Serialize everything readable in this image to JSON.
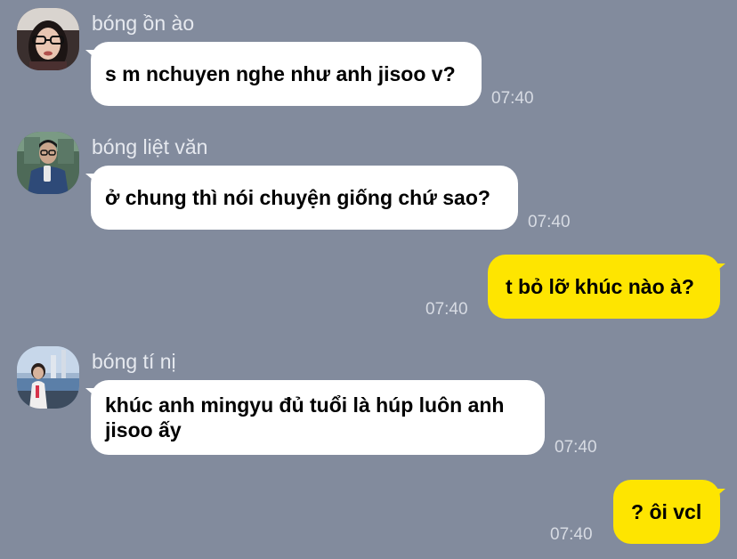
{
  "colors": {
    "background": "#828b9d",
    "incoming_bubble": "#ffffff",
    "outgoing_bubble": "#fee500",
    "name_text": "#e6e9ef",
    "time_text": "#d7dbe3"
  },
  "messages": [
    {
      "sender": "bóng ồn ào",
      "avatar": "avatar-photo-glasses",
      "text": "s m nchuyen nghe như anh jisoo v?",
      "time": "07:40",
      "direction": "incoming"
    },
    {
      "sender": "bóng liệt văn",
      "avatar": "avatar-photo-man",
      "text": "ở chung thì nói chuyện giống chứ sao?",
      "time": "07:40",
      "direction": "incoming"
    },
    {
      "text": "t bỏ lỡ khúc nào à?",
      "time": "07:40",
      "direction": "outgoing"
    },
    {
      "sender": "bóng tí nị",
      "avatar": "avatar-photo-woman-seaside",
      "text": "khúc anh mingyu đủ tuổi là húp luôn anh jisoo ấy",
      "time": "07:40",
      "direction": "incoming"
    },
    {
      "text": "? ôi vcl",
      "time": "07:40",
      "direction": "outgoing"
    }
  ]
}
